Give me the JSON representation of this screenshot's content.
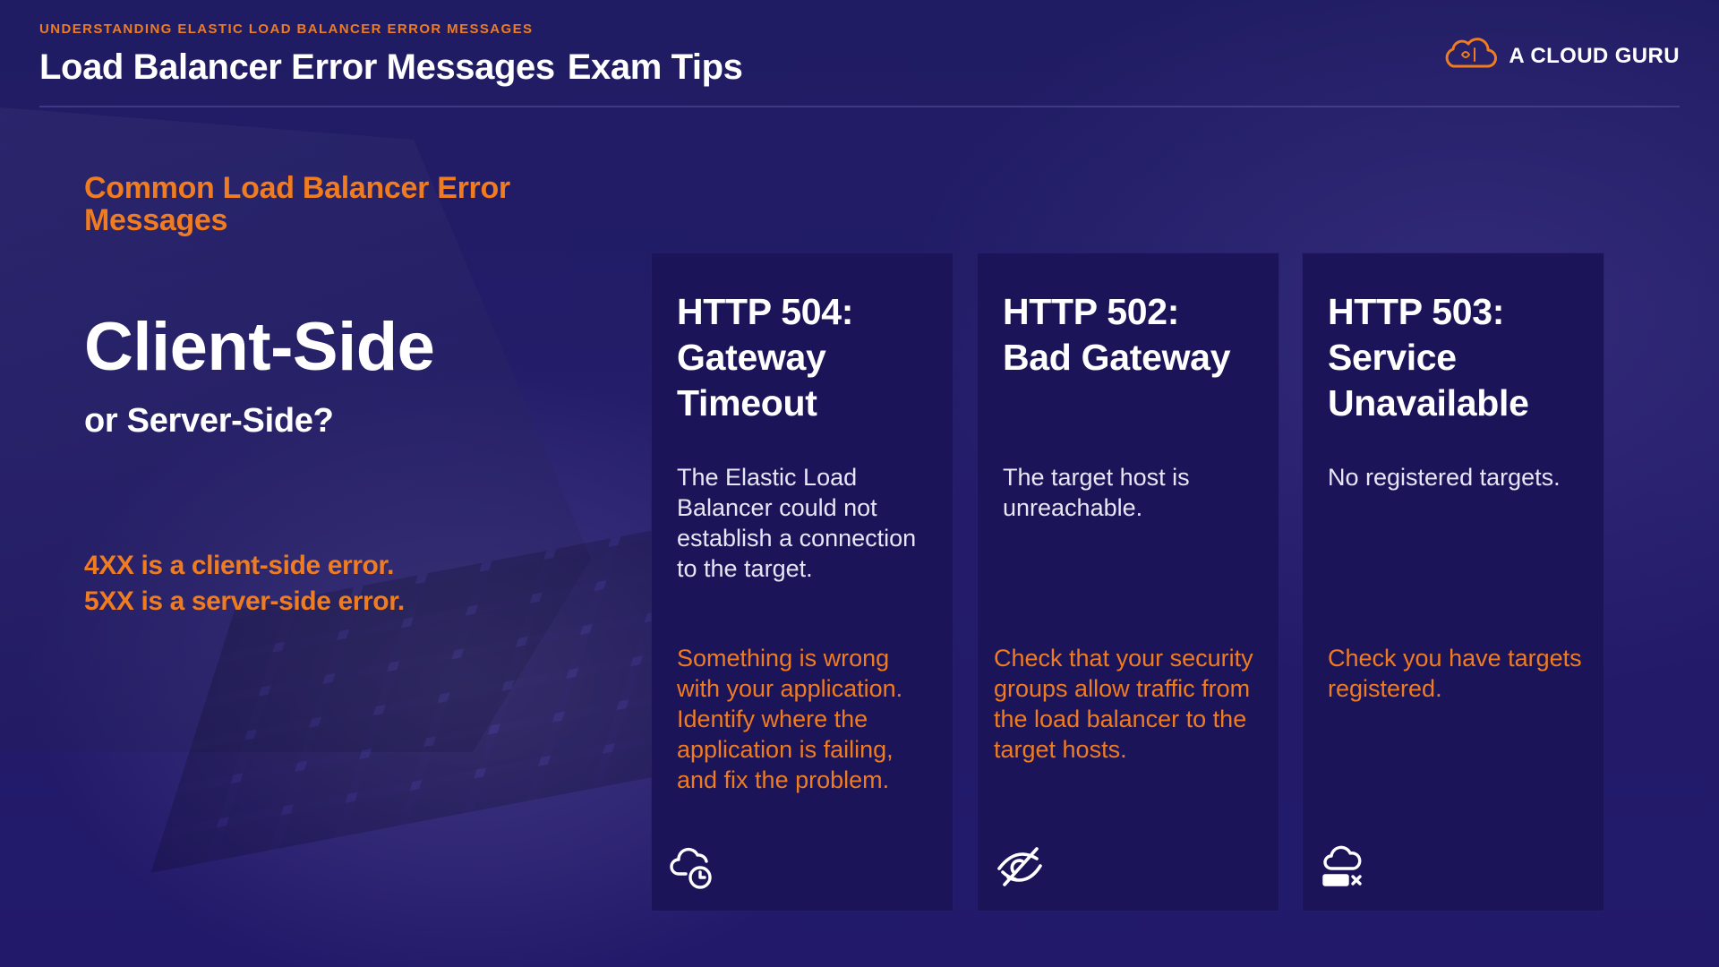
{
  "header": {
    "eyebrow": "UNDERSTANDING ELASTIC LOAD BALANCER ERROR MESSAGES",
    "title_main": "Load Balancer Error Messages",
    "title_suffix": "Exam Tips"
  },
  "brand": {
    "name": "A CLOUD GURU",
    "icon": "cloud-logo-icon",
    "accent_color": "#ef7c20"
  },
  "left": {
    "section_heading": "Common Load Balancer Error Messages",
    "big_heading": "Client-Side",
    "sub_heading": "or Server-Side?",
    "rules": [
      "4XX is a client-side error.",
      "5XX is a server-side error."
    ]
  },
  "cards": [
    {
      "title_line1": "HTTP 504:",
      "title_line2": "Gateway",
      "title_line3": "Timeout",
      "description": "The Elastic Load Balancer could not establish a connection to the target.",
      "tip": "Something is wrong with your application. Identify where the application is failing, and fix the problem.",
      "icon": "cloud-clock-icon"
    },
    {
      "title_line1": "HTTP 502:",
      "title_line2": "Bad Gateway",
      "title_line3": "",
      "description": "The target host is unreachable.",
      "tip": "Check that your security groups allow traffic from the load balancer to the target hosts.",
      "icon": "eye-off-icon"
    },
    {
      "title_line1": "HTTP 503:",
      "title_line2": "Service",
      "title_line3": "Unavailable",
      "description": "No registered targets.",
      "tip": "Check you have targets registered.",
      "icon": "cloud-server-x-icon"
    }
  ],
  "colors": {
    "background": "#221b66",
    "card_background": "#1c1459",
    "accent": "#ef7c20",
    "text": "#ffffff"
  }
}
